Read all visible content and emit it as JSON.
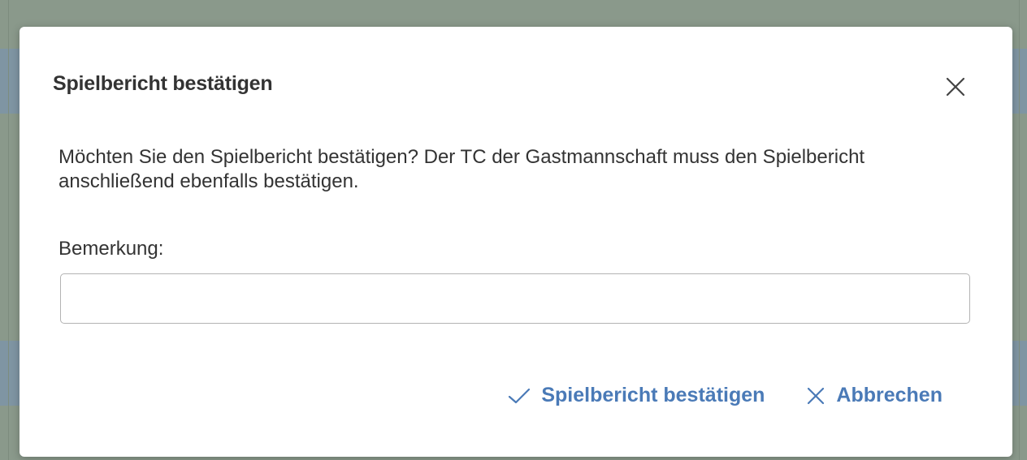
{
  "dialog": {
    "title": "Spielbericht bestätigen",
    "message": "Möchten Sie den Spielbericht bestätigen? Der TC der Gastmannschaft muss den Spielbericht anschließend ebenfalls bestätigen.",
    "remark_label": "Bemerkung:",
    "remark_value": "",
    "remark_placeholder": "",
    "confirm_label": "Spielbericht bestätigen",
    "cancel_label": "Abbrechen",
    "close_icon": "close-icon",
    "confirm_icon": "check-icon",
    "cancel_icon": "close-icon"
  },
  "colors": {
    "accent": "#4a7ab7",
    "text": "#333333",
    "backdrop": "#8a998b"
  }
}
